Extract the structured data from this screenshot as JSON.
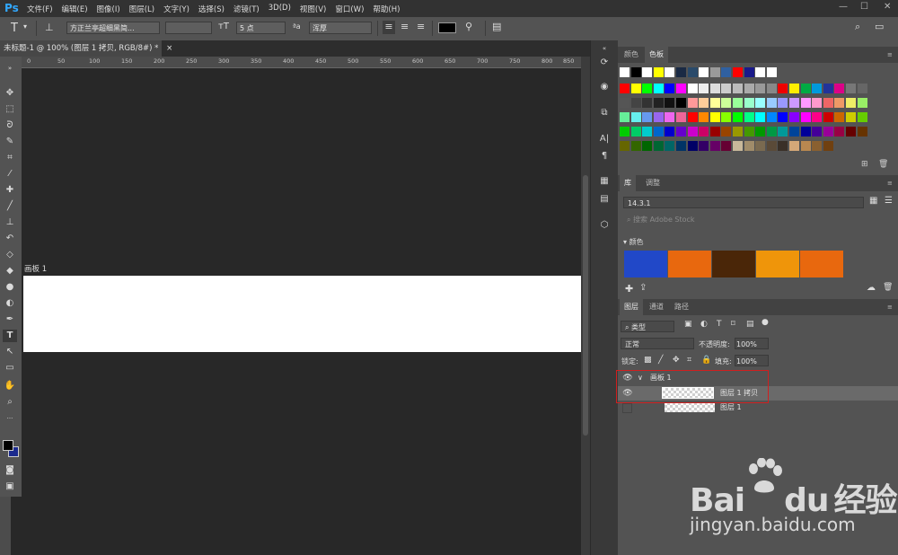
{
  "app": {
    "logo": "Ps"
  },
  "menu": [
    "文件(F)",
    "编辑(E)",
    "图像(I)",
    "图层(L)",
    "文字(Y)",
    "选择(S)",
    "滤镜(T)",
    "3D(D)",
    "视图(V)",
    "窗口(W)",
    "帮助(H)"
  ],
  "window_controls": {
    "minimize": "—",
    "maximize": "☐",
    "close": "✕"
  },
  "options": {
    "font_family": "方正兰亭超细黑简...",
    "font_size": "5 点",
    "antialias": "浑厚",
    "text_color": "#000000"
  },
  "document_tab": {
    "title": "未标题-1 @ 100% (图层 1 拷贝, RGB/8#) *",
    "close": "×"
  },
  "ruler_ticks": [
    "0",
    "50",
    "100",
    "150",
    "200",
    "250",
    "300",
    "350",
    "400",
    "450",
    "500",
    "550",
    "600",
    "650",
    "700",
    "750",
    "800",
    "850"
  ],
  "canvas": {
    "artboard_label": "画板 1"
  },
  "swatches_panel": {
    "tabs": [
      "颜色",
      "色板"
    ],
    "active_tab": "色板",
    "rows": [
      [
        "#ffffff",
        "#000000",
        "#ffffff",
        "#ffff00",
        "#ffffff",
        "#1a2a44",
        "#2a4a6a",
        "#ffffff",
        "#9a9a9a",
        "#3060a0",
        "#ff0000",
        "#1a1a8a",
        "#ffffff",
        "#ffffff"
      ],
      [
        "#ff0000",
        "#ffff00",
        "#00ff00",
        "#00ffff",
        "#0000ff",
        "#ff00ff",
        "#ffffff",
        "#eeeeee",
        "#dddddd",
        "#cccccc",
        "#bbbbbb",
        "#aaaaaa",
        "#999999",
        "#888888",
        "#ee0000",
        "#ffee00",
        "#00aa44",
        "#0099dd",
        "#223399",
        "#dd0088",
        "#777777",
        "#666666"
      ],
      [
        "#555555",
        "#444444",
        "#333333",
        "#222222",
        "#111111",
        "#000000",
        "#ff9999",
        "#ffcc99",
        "#ffff99",
        "#ccff99",
        "#99ff99",
        "#99ffcc",
        "#99ffff",
        "#99ccff",
        "#9999ff",
        "#cc99ff",
        "#ff99ff",
        "#ff99cc",
        "#ee6666",
        "#ee9966",
        "#eeee66",
        "#99ee66"
      ],
      [
        "#66ee99",
        "#66eeee",
        "#6699ee",
        "#9966ee",
        "#ee66ee",
        "#ee6699",
        "#ff0000",
        "#ff8800",
        "#ffff00",
        "#88ff00",
        "#00ff00",
        "#00ff88",
        "#00ffff",
        "#0088ff",
        "#0000ff",
        "#8800ff",
        "#ff00ff",
        "#ff0088",
        "#cc0000",
        "#cc6600",
        "#cccc00",
        "#66cc00"
      ],
      [
        "#00cc00",
        "#00cc66",
        "#00cccc",
        "#0066cc",
        "#0000cc",
        "#6600cc",
        "#cc00cc",
        "#cc0066",
        "#990000",
        "#994400",
        "#999900",
        "#449900",
        "#009900",
        "#009944",
        "#009999",
        "#004499",
        "#000099",
        "#440099",
        "#990099",
        "#990044",
        "#660000",
        "#663300"
      ],
      [
        "#666600",
        "#336600",
        "#006600",
        "#006633",
        "#006666",
        "#003366",
        "#000066",
        "#330066",
        "#660066",
        "#660033",
        "#c8b89a",
        "#a08c6a",
        "#7a6a50",
        "#5a4a38",
        "#3a3028",
        "#d4a878",
        "#b88850",
        "#8a6030",
        "#704010"
      ]
    ]
  },
  "library_panel": {
    "tabs": [
      "库",
      "调整"
    ],
    "active_tab": "库",
    "library_name": "14.3.1",
    "search_placeholder": "搜索 Adobe Stock",
    "group_label": "颜色",
    "colors": [
      "#2148c8",
      "#e8680e",
      "#4a2608",
      "#ef950a",
      "#e8680e"
    ]
  },
  "layers_panel": {
    "tabs": [
      "图层",
      "通道",
      "路径"
    ],
    "active_tab": "图层",
    "filter_label": "类型",
    "blend_mode": "正常",
    "opacity_label": "不透明度:",
    "opacity_value": "100%",
    "lock_label": "锁定:",
    "fill_label": "填充:",
    "fill_value": "100%",
    "layers": [
      {
        "name": "画板 1",
        "visible": true,
        "type": "artboard"
      },
      {
        "name": "图层 1 拷贝",
        "visible": true,
        "type": "layer",
        "selected": true
      },
      {
        "name": "图层 1",
        "visible": false,
        "type": "layer"
      }
    ]
  },
  "watermark": {
    "brand_a": "Bai",
    "brand_b": "du",
    "brand_c": "经验",
    "url": "jingyan.baidu.com"
  }
}
